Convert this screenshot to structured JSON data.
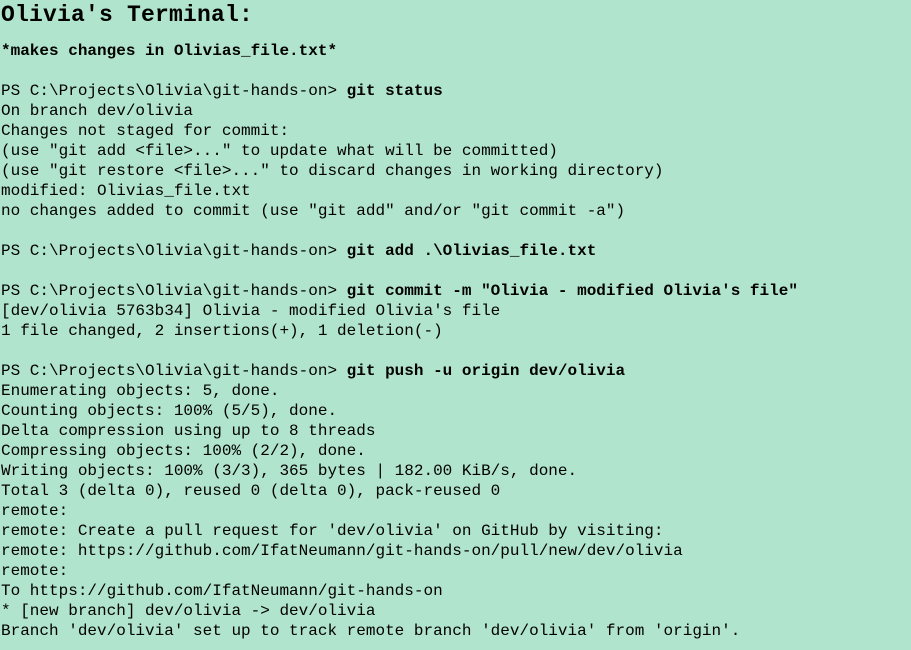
{
  "title": "Olivia's Terminal:",
  "note": "*makes changes in Olivias_file.txt*",
  "prompt": "PS C:\\Projects\\Olivia\\git-hands-on> ",
  "blocks": [
    {
      "command": "git status",
      "output": [
        "On branch dev/olivia",
        "Changes not staged for commit:",
        "(use \"git add <file>...\" to update what will be committed)",
        "(use \"git restore <file>...\" to discard changes in working directory)",
        "modified: Olivias_file.txt",
        "no changes added to commit (use \"git add\" and/or \"git commit -a\")"
      ]
    },
    {
      "command": "git add .\\Olivias_file.txt",
      "output": []
    },
    {
      "command": "git commit -m \"Olivia - modified Olivia's file\"",
      "output": [
        "[dev/olivia 5763b34] Olivia - modified Olivia's file",
        "1 file changed, 2 insertions(+), 1 deletion(-)"
      ]
    },
    {
      "command": "git push -u origin dev/olivia",
      "output": [
        "Enumerating objects: 5, done.",
        "Counting objects: 100% (5/5), done.",
        "Delta compression using up to 8 threads",
        "Compressing objects: 100% (2/2), done.",
        "Writing objects: 100% (3/3), 365 bytes | 182.00 KiB/s, done.",
        "Total 3 (delta 0), reused 0 (delta 0), pack-reused 0",
        "remote:",
        "remote: Create a pull request for 'dev/olivia' on GitHub by visiting:",
        "remote: https://github.com/IfatNeumann/git-hands-on/pull/new/dev/olivia",
        "remote:",
        "To https://github.com/IfatNeumann/git-hands-on",
        "* [new branch] dev/olivia -> dev/olivia",
        "Branch 'dev/olivia' set up to track remote branch 'dev/olivia' from 'origin'."
      ]
    }
  ]
}
